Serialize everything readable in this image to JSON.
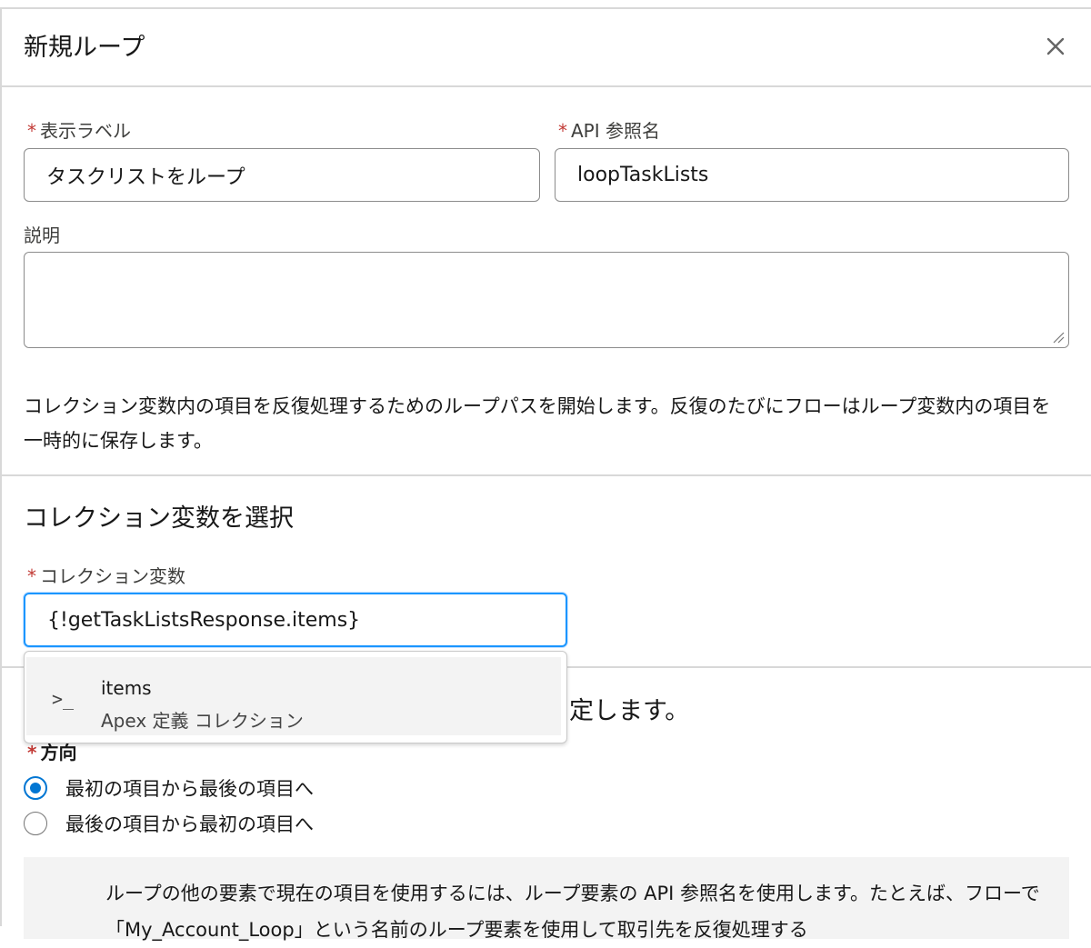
{
  "modal": {
    "title": "新規ループ"
  },
  "fields": {
    "label": {
      "required_mark": "*",
      "label": "表示ラベル",
      "value": "タスクリストをループ"
    },
    "api_name": {
      "required_mark": "*",
      "label": "API 参照名",
      "value": "loopTaskLists"
    },
    "description": {
      "label": "説明",
      "value": ""
    }
  },
  "help_text": "コレクション変数内の項目を反復処理するためのループパスを開始します。反復のたびにフローはループ変数内の項目を一時的に保存します。",
  "collection_section": {
    "title": "コレクション変数を選択",
    "field": {
      "required_mark": "*",
      "label": "コレクション変数",
      "value": "{!getTaskListsResponse.items}"
    }
  },
  "dropdown": {
    "options": [
      {
        "icon": "terminal-icon",
        "icon_glyph": ">_",
        "name": "items",
        "type": "Apex 定義 コレクション"
      }
    ]
  },
  "order_section": {
    "partial_heading": "定します。",
    "direction_label": "方向",
    "options": [
      {
        "label": "最初の項目から最後の項目へ",
        "checked": true
      },
      {
        "label": "最後の項目から最初の項目へ",
        "checked": false
      }
    ]
  },
  "info_text": "ループの他の要素で現在の項目を使用するには、ループ要素の API 参照名を使用します。たとえば、フローで「My_Account_Loop」という名前のループ要素を使用して取引先を反復処理する"
}
